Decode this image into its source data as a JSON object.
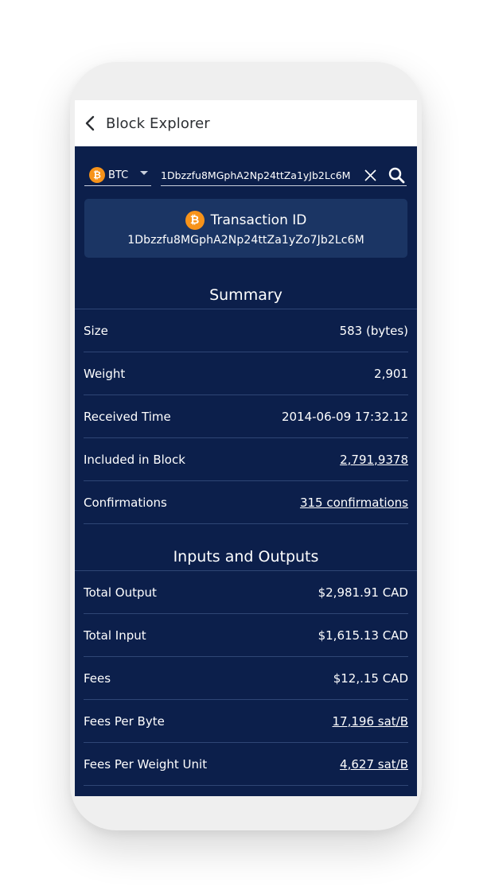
{
  "appbar": {
    "title": "Block Explorer"
  },
  "search": {
    "coin": "BTC",
    "coin_symbol": "₿",
    "query": "1Dbzzfu8MGphA2Np24ttZa1yJb2Lc6M"
  },
  "transaction": {
    "label": "Transaction ID",
    "id": "1Dbzzfu8MGphA2Np24ttZa1yZo7Jb2Lc6M"
  },
  "summary": {
    "title": "Summary",
    "rows": [
      {
        "label": "Size",
        "value": "583 (bytes)"
      },
      {
        "label": "Weight",
        "value": "2,901"
      },
      {
        "label": "Received Time",
        "value": "2014-06-09 17:32.12"
      },
      {
        "label": "Included in Block",
        "value": "2,791,9378"
      },
      {
        "label": "Confirmations",
        "value": "315 confirmations"
      }
    ]
  },
  "io": {
    "title": "Inputs and Outputs",
    "rows": [
      {
        "label": "Total Output",
        "value": "$2,981.91 CAD"
      },
      {
        "label": "Total Input",
        "value": "$1,615.13 CAD"
      },
      {
        "label": "Fees",
        "value": "$12,.15 CAD"
      },
      {
        "label": "Fees Per Byte",
        "value": "17,196 sat/B"
      },
      {
        "label": "Fees Per Weight Unit",
        "value": "4,627 sat/B"
      }
    ]
  },
  "colors": {
    "background": "#0c1f4b",
    "card": "#1b3564",
    "accent_btc": "#f7931a",
    "appbar": "#ffffff"
  },
  "icons": [
    "back-arrow-icon",
    "bitcoin-icon",
    "dropdown-caret-icon",
    "close-icon",
    "search-icon"
  ]
}
